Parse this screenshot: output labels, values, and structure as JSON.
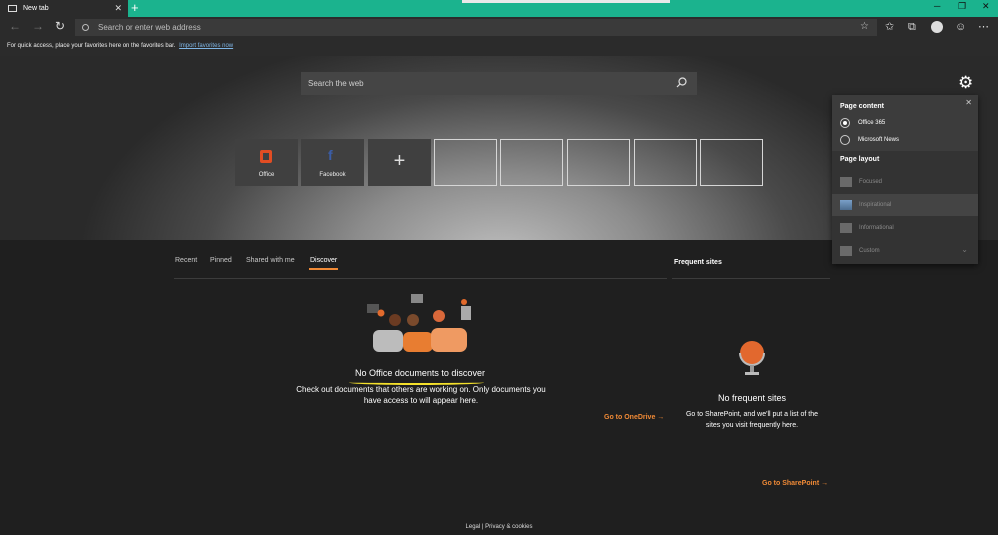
{
  "browser": {
    "tab_label": "New tab",
    "tab_close": "✕",
    "new_tab": "+",
    "window_controls": [
      "─",
      "❐",
      "✕"
    ],
    "nav": {
      "back": "←",
      "forward": "→",
      "refresh": "↻"
    },
    "address_placeholder": "Search or enter web address",
    "toolbar_icons": [
      "☆",
      "✩",
      "⧉",
      "☺",
      "⋯"
    ]
  },
  "favorites_bar": {
    "text": "For quick access, place your favorites here on the favorites bar.",
    "link": "Import favorites now"
  },
  "hero": {
    "search_placeholder": "Search the web",
    "gear": "⚙",
    "tiles": [
      {
        "label": "Office",
        "kind": "office"
      },
      {
        "label": "Facebook",
        "kind": "facebook"
      },
      {
        "label": "",
        "kind": "add",
        "glyph": "+"
      }
    ],
    "empty_tile_count": 5
  },
  "content": {
    "tabs": [
      "Recent",
      "Pinned",
      "Shared with me",
      "Discover"
    ],
    "active_tab": "Discover",
    "empty_title": "No Office documents to discover",
    "empty_desc": "Check out documents that others are working on. Only documents you have access to will appear here.",
    "onedrive_link": "Go to OneDrive",
    "arrow": "→"
  },
  "frequent": {
    "title": "Frequent sites",
    "empty_title": "No frequent sites",
    "empty_desc": "Go to SharePoint, and we'll put a list of the sites you visit frequently here.",
    "sharepoint_link": "Go to SharePoint"
  },
  "footer": {
    "legal": "Legal",
    "sep": " | ",
    "privacy": "Privacy & cookies"
  },
  "settings_panel": {
    "close": "✕",
    "page_content_heading": "Page content",
    "content_options": [
      {
        "label": "Office 365",
        "selected": true
      },
      {
        "label": "Microsoft News",
        "selected": false
      }
    ],
    "page_layout_heading": "Page layout",
    "layout_options": [
      {
        "label": "Focused",
        "selected": false
      },
      {
        "label": "Inspirational",
        "selected": true
      },
      {
        "label": "Informational",
        "selected": false
      },
      {
        "label": "Custom",
        "selected": false
      }
    ],
    "chevron": "⌄"
  },
  "colors": {
    "accent": "#1bb38e",
    "link_orange": "#f08a36",
    "highlight_yellow": "#f4e02b"
  }
}
